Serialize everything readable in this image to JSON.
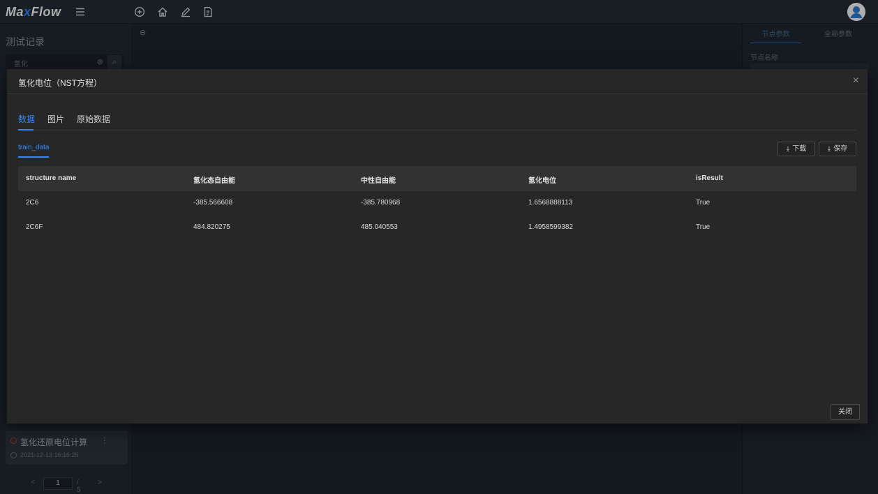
{
  "app": {
    "logo_main_1": "Ma",
    "logo_x": "x",
    "logo_main_2": "Flow"
  },
  "topbar": {
    "icons": [
      "menu-icon",
      "plus-circle-icon",
      "home-icon",
      "pencil-icon",
      "document-icon"
    ],
    "avatar_icon": "user-avatar-icon"
  },
  "sidebar": {
    "title": "测试记录",
    "search_value": "氢化",
    "card": {
      "name": "氢化还原电位计算",
      "time": "2021-12-13 16:16:25"
    },
    "pager": {
      "prev": "<",
      "page": "1",
      "total": "/ 5",
      "next": ">"
    }
  },
  "right_panel": {
    "tab_active": "节点参数",
    "tab_other": "全局参数",
    "label": "节点名称"
  },
  "modal": {
    "title": "氢化电位（NST方程）",
    "close_icon": "×",
    "tabs": [
      {
        "label": "数据",
        "active": true
      },
      {
        "label": "图片",
        "active": false
      },
      {
        "label": "原始数据",
        "active": false
      }
    ],
    "subtab": "train_data",
    "download_label": "下载",
    "save_label": "保存",
    "download_icon": "⤓",
    "table": {
      "headers": [
        "structure name",
        "氢化态自由能",
        "中性自由能",
        "氢化电位",
        "isResult"
      ],
      "rows": [
        [
          "2C6",
          "-385.566608",
          "-385.780968",
          "1.6568888113",
          "True"
        ],
        [
          "2C6F",
          "484.820275",
          "485.040553",
          "1.4958599382",
          "True"
        ]
      ]
    },
    "footer_close_label": "关闭"
  }
}
